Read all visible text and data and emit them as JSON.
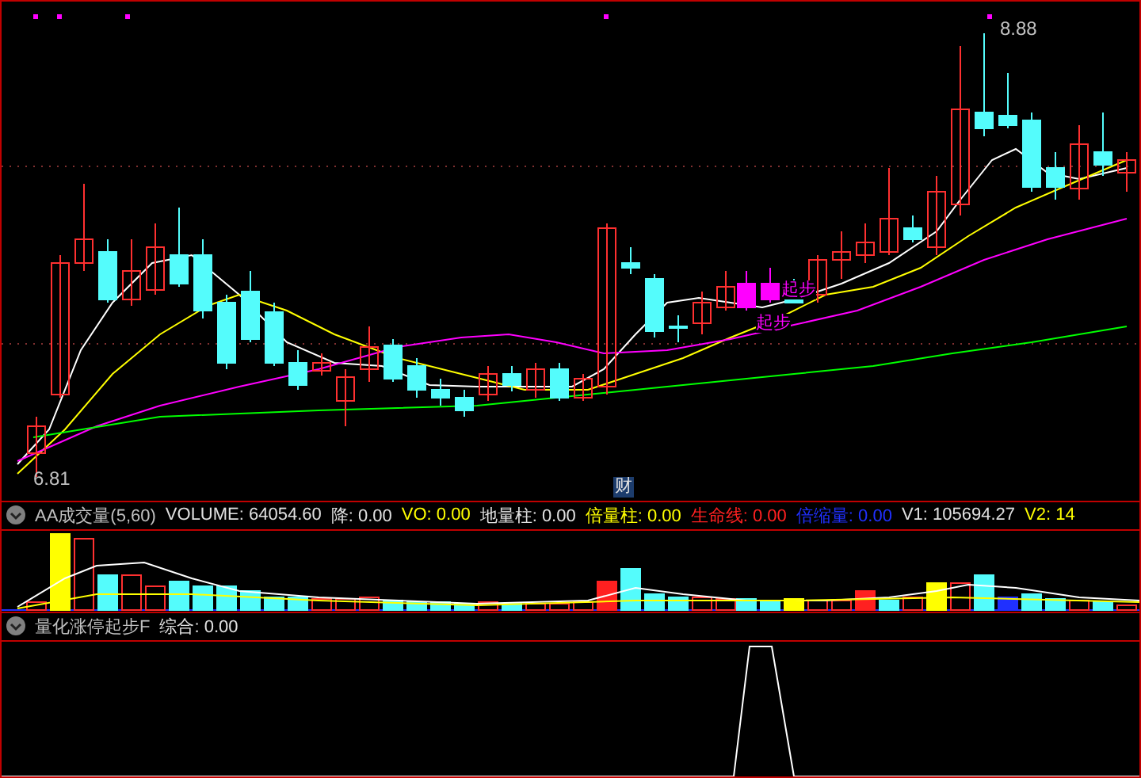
{
  "price_chart": {
    "high_label": "8.88",
    "low_label": "6.81",
    "marker_badge": "财",
    "signal_labels": [
      "起步",
      "起步"
    ]
  },
  "volume_panel": {
    "title": "AA成交量(5,60)",
    "indicators": [
      {
        "text": "VOLUME: 64054.60",
        "color": "#e0e0e0"
      },
      {
        "text": "降: 0.00",
        "color": "#e0e0e0"
      },
      {
        "text": "VO: 0.00",
        "color": "#ffff00"
      },
      {
        "text": "地量柱: 0.00",
        "color": "#e0e0e0"
      },
      {
        "text": "倍量柱: 0.00",
        "color": "#ffff00"
      },
      {
        "text": "生命线: 0.00",
        "color": "#ff2020"
      },
      {
        "text": "倍缩量: 0.00",
        "color": "#2030ff"
      },
      {
        "text": "V1: 105694.27",
        "color": "#e0e0e0"
      },
      {
        "text": "V2: 14",
        "color": "#ffff00"
      }
    ]
  },
  "signal_panel": {
    "title": "量化涨停起步F",
    "indicators": [
      {
        "text": "综合: 0.00",
        "color": "#e0e0e0"
      }
    ]
  }
}
